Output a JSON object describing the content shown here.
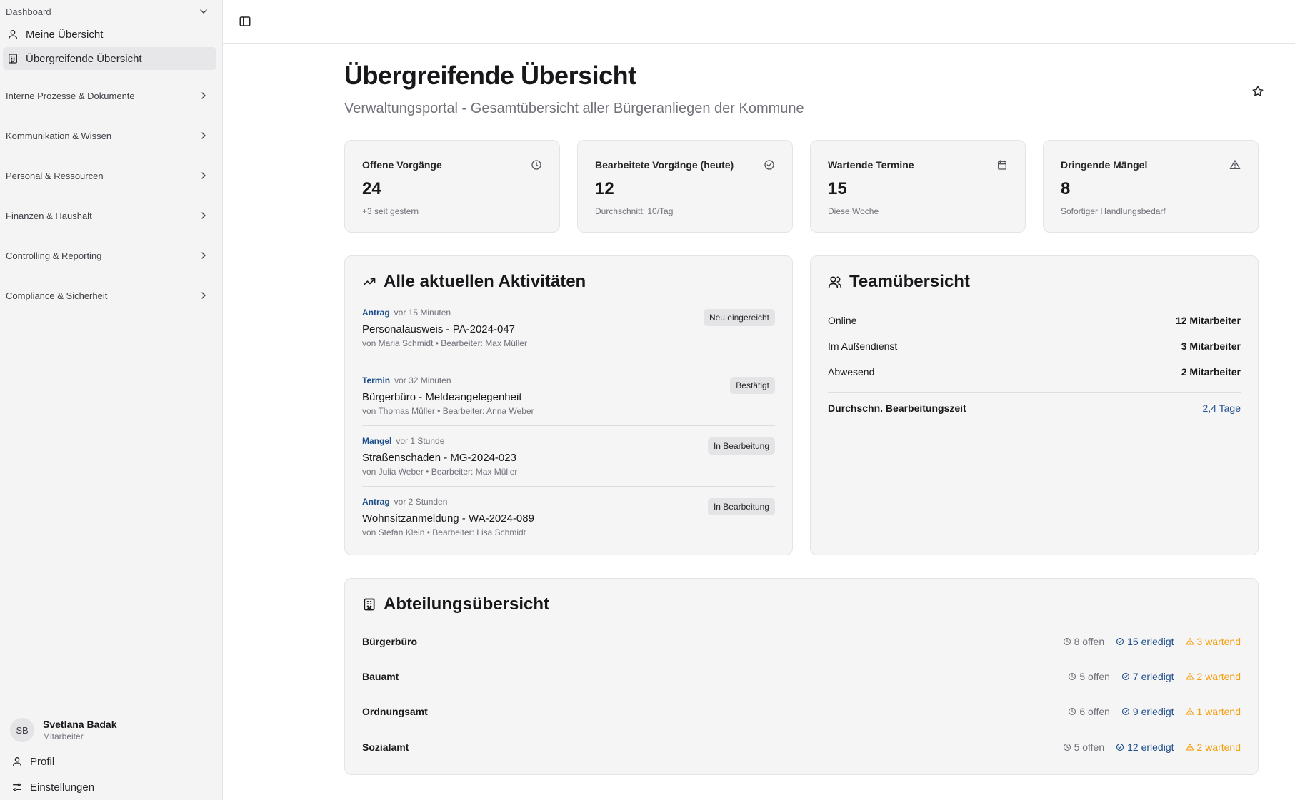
{
  "sidebar": {
    "dashboard_label": "Dashboard",
    "items": [
      {
        "label": "Meine Übersicht"
      },
      {
        "label": "Übergreifende Übersicht"
      }
    ],
    "sections": [
      {
        "label": "Interne Prozesse & Dokumente"
      },
      {
        "label": "Kommunikation & Wissen"
      },
      {
        "label": "Personal & Ressourcen"
      },
      {
        "label": "Finanzen & Haushalt"
      },
      {
        "label": "Controlling & Reporting"
      },
      {
        "label": "Compliance & Sicherheit"
      }
    ],
    "user": {
      "initials": "SB",
      "name": "Svetlana Badak",
      "role": "Mitarbeiter"
    },
    "footer": {
      "profile": "Profil",
      "settings": "Einstellungen"
    }
  },
  "page": {
    "title": "Übergreifende Übersicht",
    "subtitle": "Verwaltungsportal - Gesamtübersicht aller Bürgeranliegen der Kommune"
  },
  "stats": [
    {
      "label": "Offene Vorgänge",
      "value": "24",
      "sub": "+3 seit gestern",
      "icon": "clock-icon"
    },
    {
      "label": "Bearbeitete Vorgänge (heute)",
      "value": "12",
      "sub": "Durchschnitt: 10/Tag",
      "icon": "check-circle-icon"
    },
    {
      "label": "Wartende Termine",
      "value": "15",
      "sub": "Diese Woche",
      "icon": "calendar-icon"
    },
    {
      "label": "Dringende Mängel",
      "value": "8",
      "sub": "Sofortiger Handlungsbedarf",
      "icon": "alert-triangle-icon"
    }
  ],
  "activities": {
    "title": "Alle aktuellen Aktivitäten",
    "items": [
      {
        "type": "Antrag",
        "time": "vor 15 Minuten",
        "title": "Personalausweis - PA-2024-047",
        "by": "von Maria Schmidt • Bearbeiter: Max Müller",
        "status": "Neu eingereicht"
      },
      {
        "type": "Termin",
        "time": "vor 32 Minuten",
        "title": "Bürgerbüro - Meldeangelegenheit",
        "by": "von Thomas Müller • Bearbeiter: Anna Weber",
        "status": "Bestätigt"
      },
      {
        "type": "Mangel",
        "time": "vor 1 Stunde",
        "title": "Straßenschaden - MG-2024-023",
        "by": "von Julia Weber • Bearbeiter: Max Müller",
        "status": "In Bearbeitung"
      },
      {
        "type": "Antrag",
        "time": "vor 2 Stunden",
        "title": "Wohnsitzanmeldung - WA-2024-089",
        "by": "von Stefan Klein • Bearbeiter: Lisa Schmidt",
        "status": "In Bearbeitung"
      }
    ]
  },
  "team": {
    "title": "Teamübersicht",
    "rows": [
      {
        "label": "Online",
        "value": "12 Mitarbeiter"
      },
      {
        "label": "Im Außendienst",
        "value": "3 Mitarbeiter"
      },
      {
        "label": "Abwesend",
        "value": "2 Mitarbeiter"
      }
    ],
    "avg_label": "Durchschn. Bearbeitungszeit",
    "avg_value": "2,4 Tage"
  },
  "departments": {
    "title": "Abteilungsübersicht",
    "items": [
      {
        "name": "Bürgerbüro",
        "open": "8 offen",
        "done": "15 erledigt",
        "wait": "3 wartend"
      },
      {
        "name": "Bauamt",
        "open": "5 offen",
        "done": "7 erledigt",
        "wait": "2 wartend"
      },
      {
        "name": "Ordnungsamt",
        "open": "6 offen",
        "done": "9 erledigt",
        "wait": "1 wartend"
      },
      {
        "name": "Sozialamt",
        "open": "5 offen",
        "done": "12 erledigt",
        "wait": "2 wartend"
      }
    ]
  },
  "colors": {
    "accent": "#1e4e8c",
    "warning": "#f59e0b",
    "muted": "#71717a"
  }
}
